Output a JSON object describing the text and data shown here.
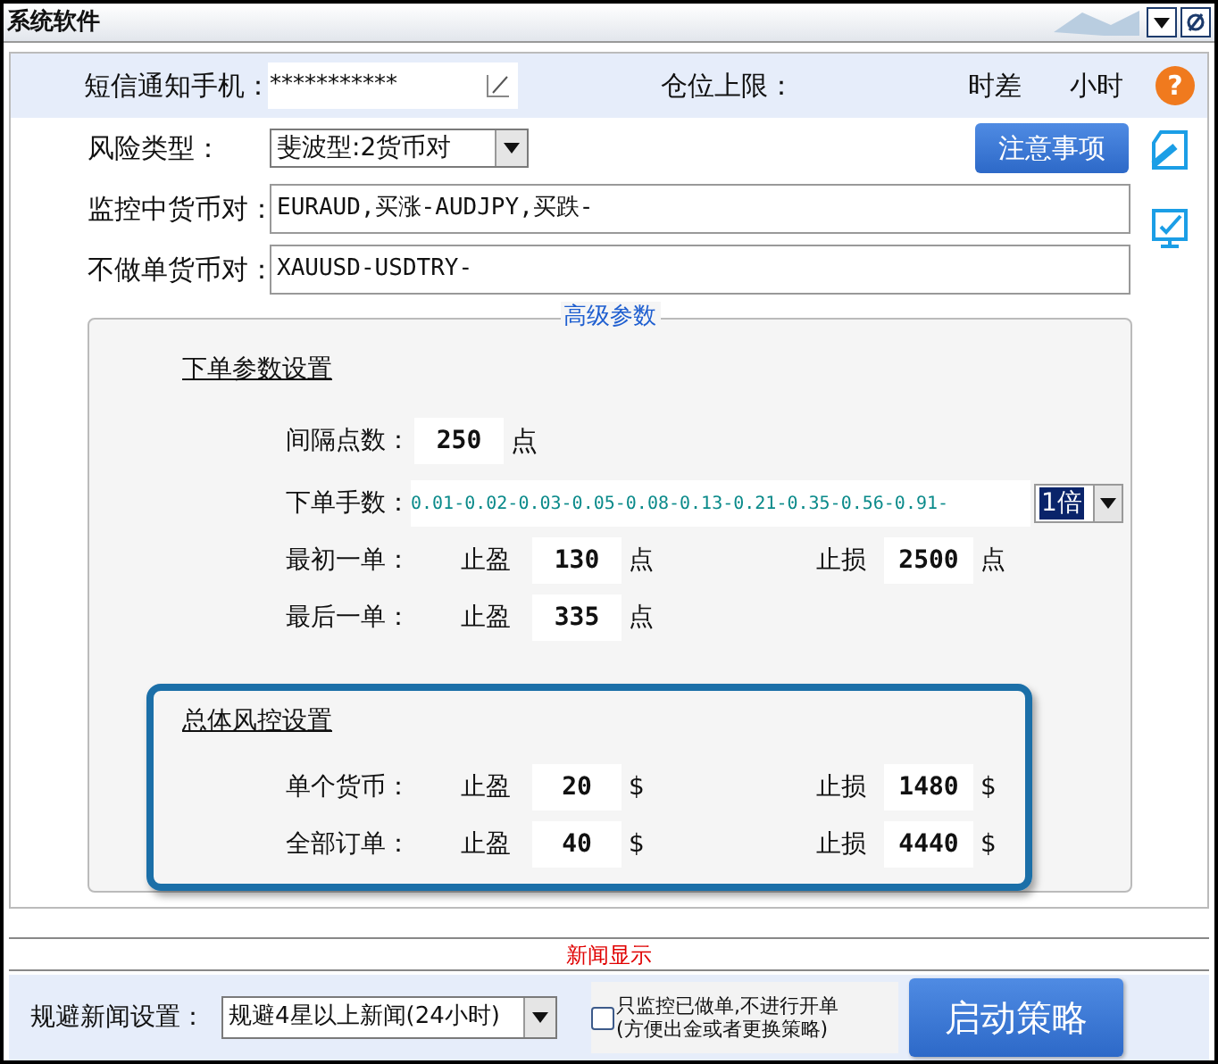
{
  "window": {
    "title": "系统软件"
  },
  "header": {
    "sms_label": "短信通知手机：",
    "sms_value": "***********",
    "position_limit_label": "仓位上限：",
    "time_diff_label": "时差",
    "hours_label": "小时",
    "help": "?"
  },
  "risk_type": {
    "label": "风险类型：",
    "value": "斐波型:2货币对"
  },
  "notice_button": "注意事项",
  "monitored_pairs": {
    "label": "监控中货币对：",
    "value": "EURAUD,买涨-AUDJPY,买跌-"
  },
  "excluded_pairs": {
    "label": "不做单货币对：",
    "value": "XAUUSD-USDTRY-"
  },
  "advanced": {
    "title": "高级参数",
    "order_section": {
      "title": "下单参数设置",
      "interval": {
        "label": "间隔点数：",
        "value": "250",
        "unit": "点"
      },
      "lots": {
        "label": "下单手数：",
        "value": "0.01-0.02-0.03-0.05-0.08-0.13-0.21-0.35-0.56-0.91-",
        "multiplier": "1倍"
      },
      "rows": [
        {
          "label": "最初一单：",
          "tp_label": "止盈",
          "tp": "130",
          "tp_unit": "点",
          "sl_label": "止损",
          "sl": "2500",
          "sl_unit": "点"
        },
        {
          "label": "最后一单：",
          "tp_label": "止盈",
          "tp": "335",
          "tp_unit": "点"
        }
      ]
    },
    "risk_section": {
      "title": "总体风控设置",
      "rows": [
        {
          "label": "单个货币：",
          "tp_label": "止盈",
          "tp": "20",
          "tp_unit": "$",
          "sl_label": "止损",
          "sl": "1480",
          "sl_unit": "$"
        },
        {
          "label": "全部订单：",
          "tp_label": "止盈",
          "tp": "40",
          "tp_unit": "$",
          "sl_label": "止损",
          "sl": "4440",
          "sl_unit": "$"
        }
      ]
    }
  },
  "news": {
    "title": "新闻显示",
    "avoid_label": "规避新闻设置：",
    "avoid_value": "规避4星以上新闻(24小时)",
    "monitor_only": {
      "label": "只监控已做单,不进行开单\n(方便出金或者更换策略)",
      "checked": false
    }
  },
  "start_button": "启动策略"
}
